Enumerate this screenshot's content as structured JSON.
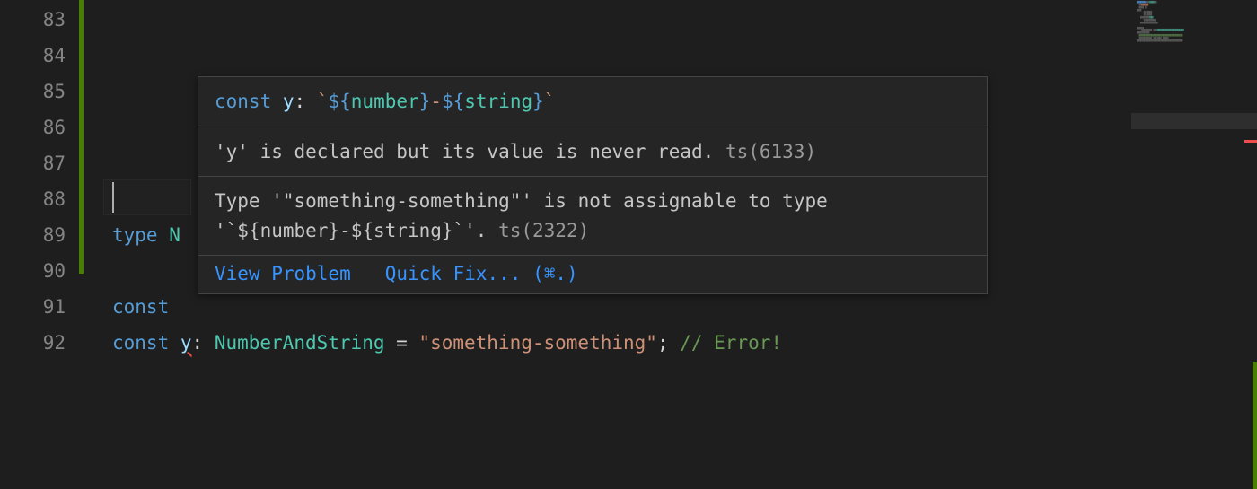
{
  "gutter": {
    "line_numbers": [
      "83",
      "84",
      "85",
      "86",
      "87",
      "88",
      "89",
      "90",
      "91",
      "92"
    ]
  },
  "code": {
    "line89": {
      "type_kw": "type",
      "type_name_prefix": "N"
    },
    "line91": {
      "const_kw": "const"
    },
    "line92": {
      "const_kw": "const",
      "var_name": "y",
      "colon": ": ",
      "type_name": "NumberAndString",
      "eq": " = ",
      "string_val": "\"something-something\"",
      "semi": "; ",
      "comment": "// Error!"
    }
  },
  "hover": {
    "signature": {
      "const_kw": "const",
      "var_name": "y",
      "colon": ": ",
      "tmpl_open": "`",
      "expr1_open": "${",
      "expr1_type": "number",
      "expr1_close": "}",
      "dash": "-",
      "expr2_open": "${",
      "expr2_type": "string",
      "expr2_close": "}",
      "tmpl_close": "`"
    },
    "diag1": {
      "msg": "'y' is declared but its value is never read.",
      "code": "ts(6133)"
    },
    "diag2": {
      "msg_line1": "Type '\"something-something\"' is not assignable to type",
      "msg_line2": "'`${number}-${string}`'.",
      "code": "ts(2322)"
    },
    "actions": {
      "view_problem": "View Problem",
      "quick_fix": "Quick Fix...",
      "shortcut": "(⌘.)"
    }
  }
}
